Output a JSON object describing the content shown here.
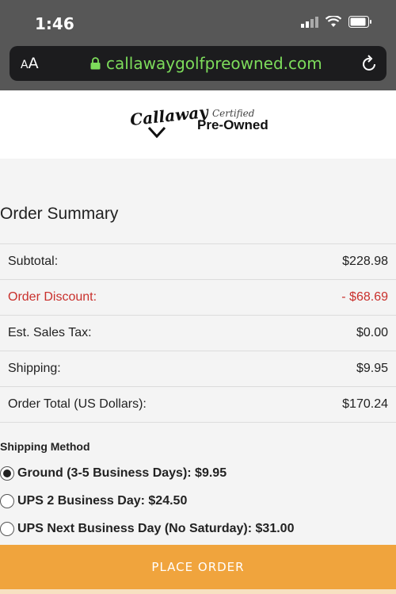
{
  "status_bar": {
    "time": "1:46"
  },
  "browser": {
    "text_size_label_small": "A",
    "text_size_label_large": "A",
    "url": "callawaygolfpreowned.com"
  },
  "header": {
    "brand": "Callaway",
    "certified": "Certified",
    "pre_owned": "Pre-Owned"
  },
  "order_summary": {
    "title": "Order Summary",
    "rows": [
      {
        "label": "Subtotal:",
        "value": "$228.98"
      },
      {
        "label": "Order Discount:",
        "value": "- $68.69"
      },
      {
        "label": "Est. Sales Tax:",
        "value": "$0.00"
      },
      {
        "label": "Shipping:",
        "value": "$9.95"
      },
      {
        "label": "Order Total (US Dollars):",
        "value": "$170.24"
      }
    ],
    "discount_color": "#c9302c"
  },
  "shipping": {
    "title": "Shipping Method",
    "options": [
      {
        "label": "Ground (3-5 Business Days): $9.95",
        "selected": true
      },
      {
        "label": "UPS 2 Business Day: $24.50",
        "selected": false
      },
      {
        "label": "UPS Next Business Day (No Saturday): $31.00",
        "selected": false
      }
    ]
  },
  "place_order": {
    "label": "PLACE ORDER",
    "color": "#f0a43d"
  }
}
